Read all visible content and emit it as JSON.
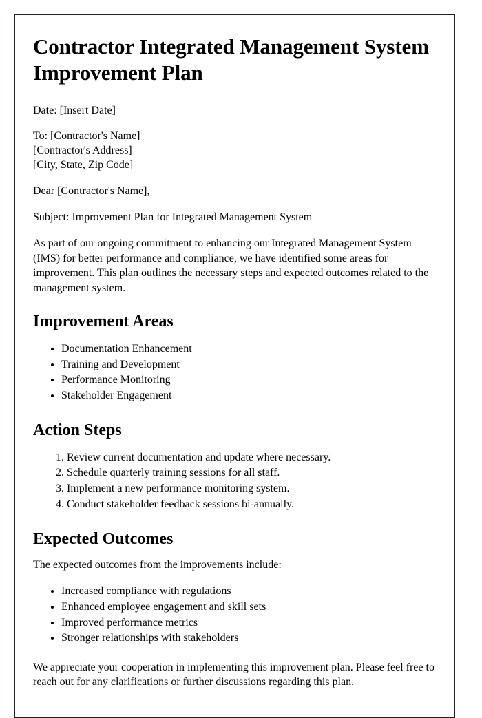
{
  "document": {
    "title": "Contractor Integrated Management System Improvement Plan",
    "date_line": "Date: [Insert Date]",
    "recipient": {
      "to_line": "To: [Contractor's Name]",
      "address_line": "[Contractor's Address]",
      "city_state_zip_line": "[City, State, Zip Code]"
    },
    "salutation": "Dear [Contractor's Name],",
    "subject_line": "Subject: Improvement Plan for Integrated Management System",
    "opening_paragraph": "As part of our ongoing commitment to enhancing our Integrated Management System (IMS) for better performance and compliance, we have identified some areas for improvement. This plan outlines the necessary steps and expected outcomes related to the management system.",
    "sections": {
      "improvement_areas": {
        "heading": "Improvement Areas",
        "items": [
          "Documentation Enhancement",
          "Training and Development",
          "Performance Monitoring",
          "Stakeholder Engagement"
        ]
      },
      "action_steps": {
        "heading": "Action Steps",
        "items": [
          "Review current documentation and update where necessary.",
          "Schedule quarterly training sessions for all staff.",
          "Implement a new performance monitoring system.",
          "Conduct stakeholder feedback sessions bi-annually."
        ]
      },
      "expected_outcomes": {
        "heading": "Expected Outcomes",
        "intro": "The expected outcomes from the improvements include:",
        "items": [
          "Increased compliance with regulations",
          "Enhanced employee engagement and skill sets",
          "Improved performance metrics",
          "Stronger relationships with stakeholders"
        ]
      }
    },
    "closing_paragraph": "We appreciate your cooperation in implementing this improvement plan. Please feel free to reach out for any clarifications or further discussions regarding this plan.",
    "colors": {
      "text": "#000000",
      "page_background": "#ffffff",
      "page_border": "#231f20"
    }
  }
}
